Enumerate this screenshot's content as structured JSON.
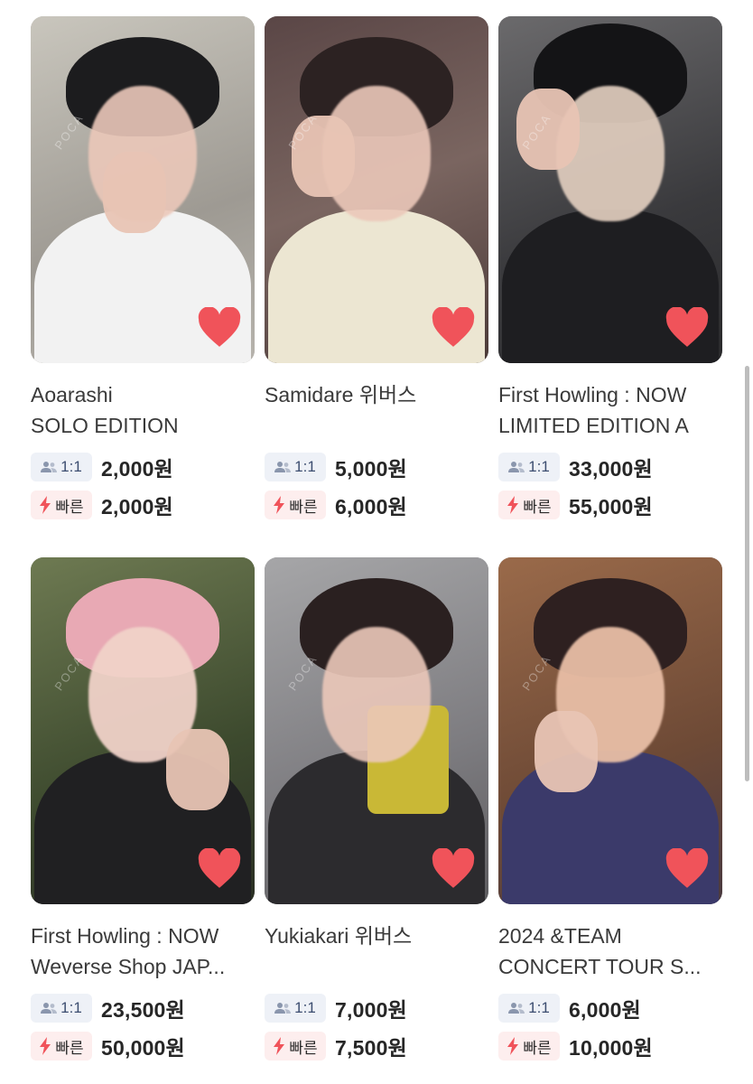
{
  "listings": [
    {
      "title_line1": "Aoarashi",
      "title_line2": "SOLO EDITION",
      "meet_label": "1:1",
      "meet_price": "2,000원",
      "fast_label": "빠른",
      "fast_price": "2,000원",
      "liked": true
    },
    {
      "title_line1": "Samidare 위버스",
      "title_line2": "",
      "meet_label": "1:1",
      "meet_price": "5,000원",
      "fast_label": "빠른",
      "fast_price": "6,000원",
      "liked": true
    },
    {
      "title_line1": "First Howling : NOW",
      "title_line2": "LIMITED EDITION A",
      "meet_label": "1:1",
      "meet_price": "33,000원",
      "fast_label": "빠른",
      "fast_price": "55,000원",
      "liked": true
    },
    {
      "title_line1": "First Howling : NOW",
      "title_line2": "Weverse Shop JAP...",
      "meet_label": "1:1",
      "meet_price": "23,500원",
      "fast_label": "빠른",
      "fast_price": "50,000원",
      "liked": true
    },
    {
      "title_line1": "Yukiakari 위버스",
      "title_line2": "",
      "meet_label": "1:1",
      "meet_price": "7,000원",
      "fast_label": "빠른",
      "fast_price": "7,500원",
      "liked": true
    },
    {
      "title_line1": "2024 &TEAM",
      "title_line2": "CONCERT TOUR S...",
      "meet_label": "1:1",
      "meet_price": "6,000원",
      "fast_label": "빠른",
      "fast_price": "10,000원",
      "liked": true
    }
  ],
  "icons": {
    "heart": "heart-icon",
    "meet": "people-icon",
    "fast": "lightning-icon"
  },
  "colors": {
    "heart": "#f0535a",
    "lightning": "#f0535a",
    "meet_badge_bg": "#eef1f7",
    "fast_badge_bg": "#fdeeee"
  }
}
